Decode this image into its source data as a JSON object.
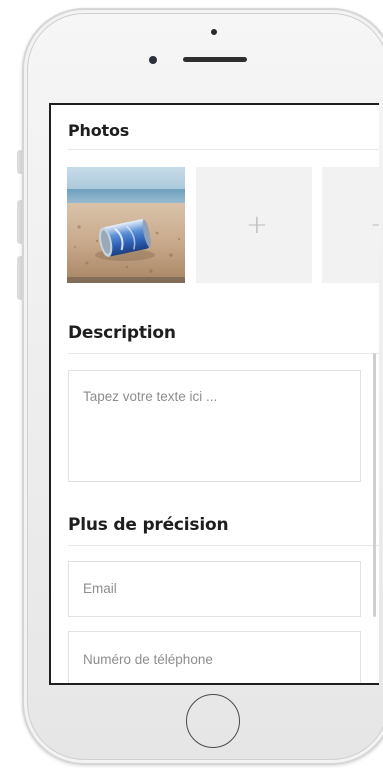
{
  "sections": {
    "photos_title": "Photos",
    "description_title": "Description",
    "details_title": "Plus de précision"
  },
  "photos": {
    "add_symbol": "+"
  },
  "fields": {
    "description_placeholder": "Tapez votre texte ici ...",
    "email_placeholder": "Email",
    "phone_placeholder": "Numéro de téléphone"
  },
  "colors": {
    "title_text": "#1e1e1e",
    "placeholder_text": "#8d8d8d",
    "tile_background": "#f2f2f2",
    "field_border": "#e2e2e2"
  }
}
